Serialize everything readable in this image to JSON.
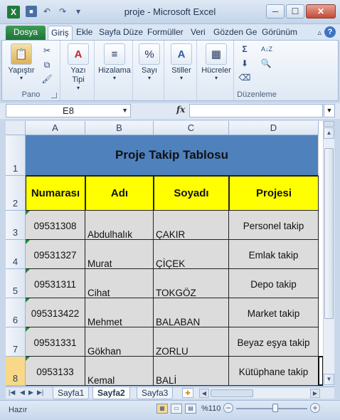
{
  "window": {
    "title": "proje - Microsoft Excel",
    "app_icon_letter": "X",
    "minimize": "─",
    "maximize": "☐",
    "close": "✕"
  },
  "qat": {
    "save_icon": "💾",
    "undo_icon": "↶",
    "redo_icon": "↷",
    "customize_icon": "▾"
  },
  "ribbon_tabs": [
    "Dosya",
    "Giriş",
    "Ekle",
    "Sayfa Düze",
    "Formüller",
    "Veri",
    "Gözden Ge",
    "Görünüm"
  ],
  "active_tab": "Giriş",
  "ribbon": {
    "groups": {
      "clipboard": {
        "label": "Pano",
        "paste": "Yapıştır"
      },
      "font": {
        "label": "Yazı Tipi"
      },
      "alignment": {
        "label": "Hizalama"
      },
      "number": {
        "label": "Sayı"
      },
      "styles": {
        "label": "Stiller"
      },
      "cells": {
        "label": "Hücreler"
      },
      "editing": {
        "label": "Düzenleme"
      }
    },
    "sigma_icon": "Σ",
    "sort_icon": "A↓Z"
  },
  "formula_bar": {
    "name_box": "E8",
    "fx": "fx",
    "formula_value": ""
  },
  "columns": [
    "A",
    "B",
    "C",
    "D"
  ],
  "rows": [
    "1",
    "2",
    "3",
    "4",
    "5",
    "6",
    "7",
    "8"
  ],
  "selected_row": "8",
  "sheet": {
    "title": "Proje Takip Tablosu",
    "headers": [
      "Numarası",
      "Adı",
      "Soyadı",
      "Projesi"
    ],
    "data": [
      [
        "09531308",
        "Abdulhalık",
        "ÇAKIR",
        "Personel takip"
      ],
      [
        "09531327",
        "Murat",
        "ÇİÇEK",
        "Emlak takip"
      ],
      [
        "09531311",
        "Cihat",
        "TOKGÖZ",
        "Depo takip"
      ],
      [
        "095313422",
        "Mehmet",
        "BALABAN",
        "Market takip"
      ],
      [
        "09531331",
        "Gökhan",
        "ZORLU",
        "Beyaz eşya takip"
      ],
      [
        "0953133",
        "Kemal",
        "BALİ",
        "Kütüphane takip"
      ]
    ]
  },
  "sheet_tabs": [
    "Sayfa1",
    "Sayfa2",
    "Sayfa3"
  ],
  "active_sheet": "Sayfa2",
  "status": {
    "ready": "Hazır",
    "zoom": "%110",
    "zoom_fraction": 0.55
  }
}
